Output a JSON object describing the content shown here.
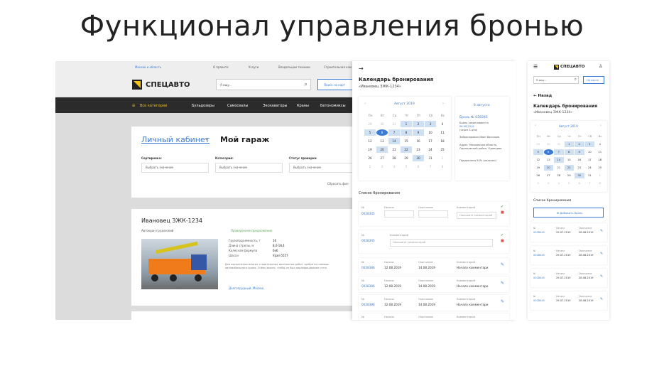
{
  "heading": "Функционал управления бронью",
  "desktop": {
    "location": "Москва и область",
    "topnav": [
      "О проекте",
      "Услуги",
      "Владельцам техники",
      "Строительная ком"
    ],
    "logo": "СПЕЦАВТО",
    "search_placeholder": "Я ищу...",
    "search_button": "Поиск на карт",
    "categories_btn": "Все категории",
    "nav": [
      "Бульдозеры",
      "Самосвалы",
      "Экскаваторы",
      "Краны",
      "Бетономиксы"
    ],
    "breadcrumb_link": "Личный кабинет",
    "page_title": "Мой гараж",
    "filters": [
      {
        "label": "Сортировка:",
        "value": "Выбрать значение"
      },
      {
        "label": "Категория:",
        "value": "Выбрать значение"
      },
      {
        "label": "Статус проверки",
        "value": "Выбрать значение"
      }
    ],
    "reset": "Сбросить фил",
    "vehicle_title": "Ивановец ЗЖК-1234",
    "vehicle_type": "Автокран грузинский",
    "verified": "Проверенное предложение",
    "specs": [
      {
        "k": "Грузоподъемность, т",
        "v": "16"
      },
      {
        "k": "Длина стрелы, м",
        "v": "8,0-18,4"
      },
      {
        "k": "Колесная формула",
        "v": "6x6"
      },
      {
        "k": "Шасси",
        "v": "Урал-5557"
      }
    ],
    "desc": "Для выполнения многих строительных монтажных работ требуется помощь автомобильного крана. Очень важно, чтобы он был квалифицирован и его",
    "vehicle_location": "Долгопрудный, Москва"
  },
  "panel": {
    "back_arrow": "→",
    "title": "Календарь бронирования",
    "subtitle": "«Ивановец ЗЖК-1234»",
    "month": "Август 2019",
    "weekdays": [
      "Пн",
      "Вт",
      "Ср",
      "Чт",
      "Пт",
      "Сб",
      "Вс"
    ],
    "days": [
      [
        "29",
        "30",
        "31",
        "1",
        "2",
        "3",
        "4"
      ],
      [
        "5",
        "6",
        "7",
        "8",
        "9",
        "10",
        "11"
      ],
      [
        "12",
        "13",
        "14",
        "15",
        "16",
        "17",
        "18"
      ],
      [
        "19",
        "20",
        "21",
        "22",
        "23",
        "24",
        "25"
      ],
      [
        "26",
        "27",
        "28",
        "29",
        "30",
        "31",
        "1"
      ],
      [
        "2",
        "3",
        "4",
        "5",
        "6",
        "7",
        "8"
      ]
    ],
    "info_date": "6 августа",
    "booking_title": "Бронь № 028345",
    "booking_status": "Бронь заканчивается",
    "booking_end": "08.08.2019",
    "booking_left": "(через 3 дня)",
    "booked_by": "Забронировал Иван Васильев",
    "address": "Адрес: Московская область, Одинцовский район, Одинцово",
    "prepay": "Предоплата 50% (оплачен)",
    "list_title": "Список бронирования",
    "col_no": "№",
    "col_start": "Начало",
    "col_end": "Окончание",
    "col_comment": "Комментарий",
    "comment_placeholder": "Напишите комментарий",
    "comment_value": "Начало комментари",
    "rows": [
      {
        "no": "0028345",
        "start": "",
        "end": ""
      },
      {
        "no": "0028345",
        "start": "",
        "end": ""
      },
      {
        "no": "0028386",
        "start": "12.08.2019",
        "end": "14.08.2019"
      },
      {
        "no": "0028386",
        "start": "12.08.2019",
        "end": "14.08.2019"
      },
      {
        "no": "0028386",
        "start": "12.08.2019",
        "end": "14.08.2019"
      }
    ]
  },
  "mobile": {
    "logo": "СПЕЦАВТО",
    "search_placeholder": "Я ищу...",
    "map_btn": "На карте",
    "back": "← Назад",
    "title": "Календарь бронирования",
    "subtitle": "«Ивановец ЗЖК-1234»",
    "month": "Август 2019",
    "list_title": "Список бронирования",
    "add_btn": "⊕ Добавить бронь",
    "rows": [
      {
        "no": "0028345",
        "start": "29.07.2019",
        "end": "28.08.2019"
      },
      {
        "no": "0028345",
        "start": "29.07.2019",
        "end": "28.08.2019"
      },
      {
        "no": "0028345",
        "start": "29.07.2019",
        "end": "28.08.2019"
      },
      {
        "no": "0028345",
        "start": "29.07.2019",
        "end": "28.08.2019"
      }
    ]
  }
}
